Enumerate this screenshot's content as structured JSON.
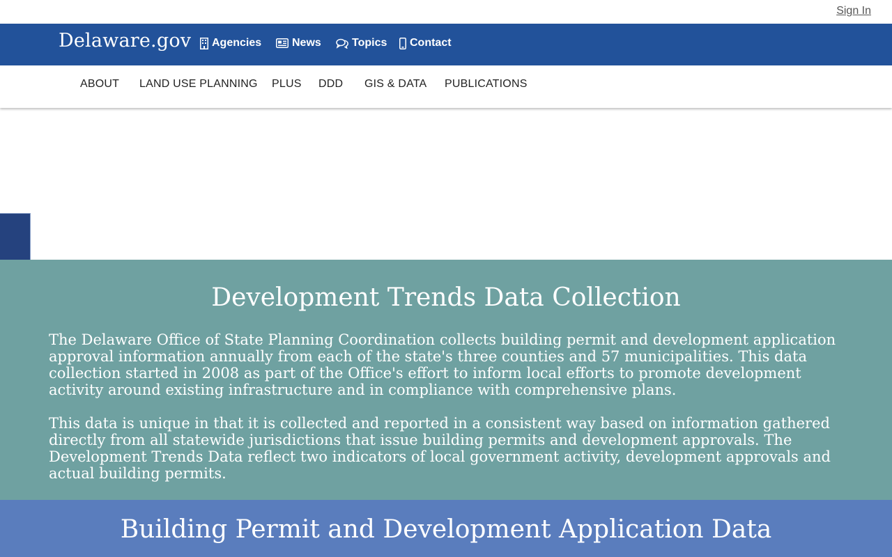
{
  "topbar": {
    "sign_in": "Sign In"
  },
  "header": {
    "brand": "Delaware.gov",
    "links": [
      {
        "label": "Agencies",
        "icon": "building-icon"
      },
      {
        "label": "News",
        "icon": "newspaper-icon"
      },
      {
        "label": "Topics",
        "icon": "comments-icon"
      },
      {
        "label": "Contact",
        "icon": "mobile-icon"
      }
    ]
  },
  "subnav": {
    "items": [
      {
        "label": "ABOUT"
      },
      {
        "label": "LAND USE PLANNING"
      },
      {
        "label": "PLUS"
      },
      {
        "label": "DDD"
      },
      {
        "label": "GIS & DATA"
      },
      {
        "label": "PUBLICATIONS"
      }
    ]
  },
  "main": {
    "title": "Development Trends Data Collection",
    "paragraphs": [
      "The Delaware Office of State Planning Coordination collects building permit and development application approval information annually from each of the state's three counties and 57 municipalities. This data collection started in 2008 as part of the Office's effort to inform local efforts to promote development activity around existing infrastructure and in compliance with comprehensive plans.",
      "This data is unique in that it is collected and reported in a consistent way based on information gathered directly from all statewide jurisdictions that issue building permits and development approvals. The Development Trends Data reflect two indicators of local government activity, development approvals and actual building permits."
    ]
  },
  "section2": {
    "title": "Building Permit and Development Application Data"
  },
  "colors": {
    "header_blue": "#22529a",
    "teal": "#6fa1a1",
    "band_blue": "#5a7dbd",
    "side_tab": "#25427e"
  }
}
